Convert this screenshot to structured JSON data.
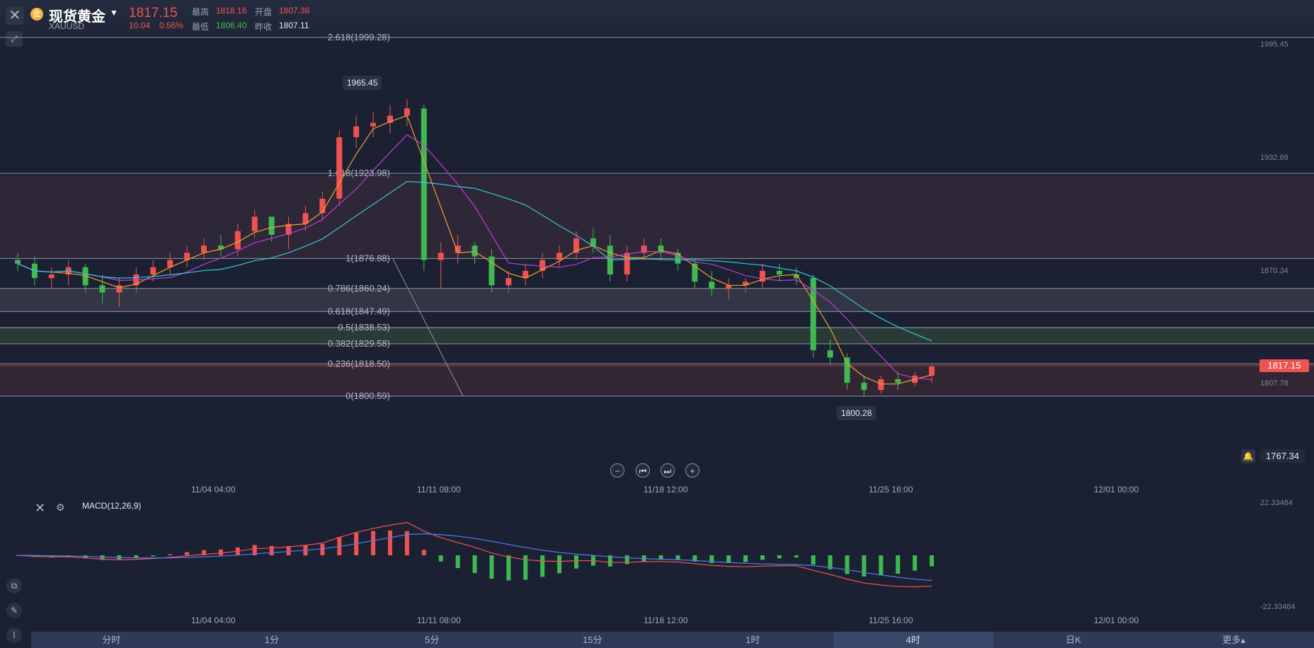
{
  "header": {
    "logo_glyph": "金",
    "name": "现货黄金",
    "code": "XAUUSD",
    "price": "1817.15",
    "change": "10.04",
    "change_pct": "0.56%",
    "high_label": "最高",
    "high": "1818.16",
    "open_label": "开盘",
    "open": "1807.38",
    "low_label": "最低",
    "low": "1806.40",
    "prev_close_label": "昨收",
    "prev_close": "1807.11"
  },
  "icons": {
    "close": "close-icon",
    "expand": "expand-icon",
    "caret": "caret-down-icon",
    "bell": "bell-icon",
    "settings": "gear-icon"
  },
  "fib": [
    {
      "label": "2.618(1999.28)",
      "price": 1999.28
    },
    {
      "label": "1.618(1923.98)",
      "price": 1923.98
    },
    {
      "label": "1(1876.88)",
      "price": 1876.88
    },
    {
      "label": "0.786(1860.24)",
      "price": 1860.24
    },
    {
      "label": "0.618(1847.49)",
      "price": 1847.49
    },
    {
      "label": "0.5(1838.53)",
      "price": 1838.53
    },
    {
      "label": "0.382(1829.58)",
      "price": 1829.58
    },
    {
      "label": "0.236(1818.50)",
      "price": 1818.5
    },
    {
      "label": "0(1800.59)",
      "price": 1800.59
    }
  ],
  "right_axis": {
    "p1": "1995.45",
    "p2": "1932.89",
    "p3": "1870.34",
    "p4": "1807.78",
    "macd_top": "22.33484",
    "macd_bottom": "-22.33484"
  },
  "tags": {
    "high_tag": "1965.45",
    "low_tag": "1800.28",
    "current_price": "1817.15",
    "alert_price": "1767.34"
  },
  "time_axis": [
    "11/04 04:00",
    "11/11 08:00",
    "11/18 12:00",
    "11/25 16:00",
    "12/01 00:00"
  ],
  "controls": {
    "zoom_out": "−",
    "prev": "⏮",
    "next": "⏭",
    "zoom_in": "+"
  },
  "macd": {
    "label": "MACD(12,26,9)"
  },
  "tabs": [
    {
      "label": "分时"
    },
    {
      "label": "1分"
    },
    {
      "label": "5分"
    },
    {
      "label": "15分"
    },
    {
      "label": "1时"
    },
    {
      "label": "4时",
      "active": true
    },
    {
      "label": "日K"
    },
    {
      "label": "更多▴"
    }
  ],
  "chart_data": {
    "type": "candlestick",
    "ylim": [
      1795,
      1999.28
    ],
    "ohlc_approx": [
      [
        1876,
        1880,
        1870,
        1874
      ],
      [
        1874,
        1878,
        1862,
        1866
      ],
      [
        1866,
        1872,
        1860,
        1868
      ],
      [
        1868,
        1876,
        1862,
        1872
      ],
      [
        1872,
        1874,
        1858,
        1862
      ],
      [
        1862,
        1868,
        1852,
        1858
      ],
      [
        1858,
        1866,
        1850,
        1862
      ],
      [
        1862,
        1872,
        1858,
        1868
      ],
      [
        1868,
        1876,
        1864,
        1872
      ],
      [
        1872,
        1880,
        1868,
        1876
      ],
      [
        1876,
        1884,
        1872,
        1880
      ],
      [
        1880,
        1888,
        1876,
        1884
      ],
      [
        1884,
        1890,
        1878,
        1882
      ],
      [
        1882,
        1896,
        1878,
        1892
      ],
      [
        1892,
        1904,
        1888,
        1900
      ],
      [
        1900,
        1898,
        1886,
        1890
      ],
      [
        1890,
        1900,
        1882,
        1896
      ],
      [
        1896,
        1906,
        1892,
        1902
      ],
      [
        1902,
        1914,
        1898,
        1910
      ],
      [
        1910,
        1948,
        1906,
        1944
      ],
      [
        1944,
        1956,
        1938,
        1950
      ],
      [
        1950,
        1958,
        1944,
        1952
      ],
      [
        1952,
        1962,
        1946,
        1956
      ],
      [
        1956,
        1965,
        1950,
        1960
      ],
      [
        1960,
        1962,
        1870,
        1876
      ],
      [
        1876,
        1886,
        1860,
        1880
      ],
      [
        1880,
        1890,
        1874,
        1884
      ],
      [
        1884,
        1886,
        1874,
        1878
      ],
      [
        1878,
        1882,
        1858,
        1862
      ],
      [
        1862,
        1870,
        1858,
        1866
      ],
      [
        1866,
        1874,
        1862,
        1870
      ],
      [
        1870,
        1880,
        1866,
        1876
      ],
      [
        1876,
        1884,
        1872,
        1880
      ],
      [
        1880,
        1892,
        1876,
        1888
      ],
      [
        1888,
        1894,
        1880,
        1884
      ],
      [
        1884,
        1890,
        1864,
        1868
      ],
      [
        1868,
        1884,
        1864,
        1880
      ],
      [
        1880,
        1888,
        1876,
        1884
      ],
      [
        1884,
        1888,
        1876,
        1880
      ],
      [
        1880,
        1882,
        1870,
        1874
      ],
      [
        1874,
        1876,
        1860,
        1864
      ],
      [
        1864,
        1870,
        1856,
        1860
      ],
      [
        1860,
        1866,
        1854,
        1862
      ],
      [
        1862,
        1866,
        1858,
        1864
      ],
      [
        1864,
        1874,
        1860,
        1870
      ],
      [
        1870,
        1874,
        1864,
        1868
      ],
      [
        1868,
        1872,
        1862,
        1866
      ],
      [
        1866,
        1868,
        1822,
        1826
      ],
      [
        1826,
        1832,
        1818,
        1822
      ],
      [
        1822,
        1824,
        1804,
        1808
      ],
      [
        1808,
        1812,
        1800,
        1804
      ],
      [
        1804,
        1812,
        1802,
        1810
      ],
      [
        1810,
        1814,
        1804,
        1808
      ],
      [
        1808,
        1814,
        1806,
        1812
      ],
      [
        1812,
        1818,
        1808,
        1817
      ]
    ]
  }
}
